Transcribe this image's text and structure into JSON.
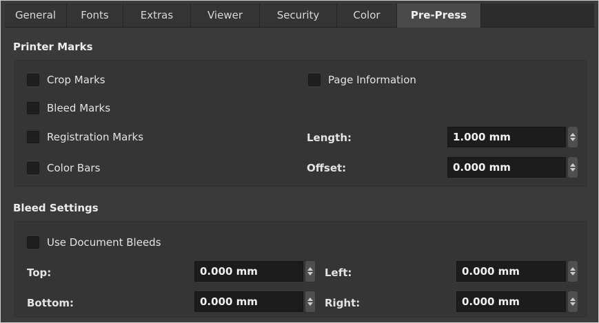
{
  "tabs": [
    {
      "label": "General"
    },
    {
      "label": "Fonts"
    },
    {
      "label": "Extras"
    },
    {
      "label": "Viewer"
    },
    {
      "label": "Security"
    },
    {
      "label": "Color"
    },
    {
      "label": "Pre-Press"
    }
  ],
  "active_tab": "Pre-Press",
  "printer_marks": {
    "title": "Printer Marks",
    "crop_marks": {
      "label": "Crop Marks",
      "checked": false
    },
    "bleed_marks": {
      "label": "Bleed Marks",
      "checked": false
    },
    "registration_marks": {
      "label": "Registration Marks",
      "checked": false
    },
    "color_bars": {
      "label": "Color Bars",
      "checked": false
    },
    "page_information": {
      "label": "Page Information",
      "checked": false
    },
    "length": {
      "label": "Length:",
      "value": "1.000 mm"
    },
    "offset": {
      "label": "Offset:",
      "value": "0.000 mm"
    }
  },
  "bleed_settings": {
    "title": "Bleed Settings",
    "use_document_bleeds": {
      "label": "Use Document Bleeds",
      "checked": false
    },
    "top": {
      "label": "Top:",
      "value": "0.000 mm"
    },
    "bottom": {
      "label": "Bottom:",
      "value": "0.000 mm"
    },
    "left": {
      "label": "Left:",
      "value": "0.000 mm"
    },
    "right": {
      "label": "Right:",
      "value": "0.000 mm"
    }
  },
  "colors": {
    "background": "#3a3a3a",
    "input_background": "#1c1c1c",
    "tab_active": "#4a4a4a"
  }
}
